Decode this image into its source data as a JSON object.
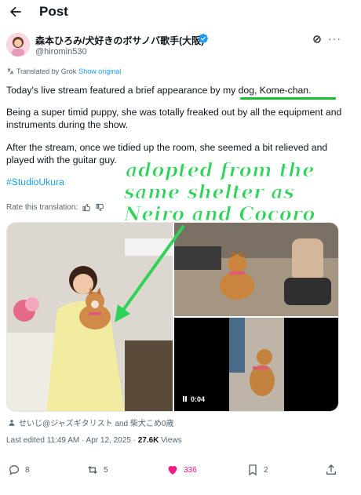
{
  "header": {
    "title": "Post"
  },
  "author": {
    "name": "森本ひろみ/犬好きのボサノバ歌手(大阪)",
    "handle": "@hiromin530"
  },
  "translation": {
    "label": "Translated by Grok",
    "show_original": "Show original"
  },
  "post": {
    "p1": "Today's live stream featured a brief appearance by my dog, Kome-chan.",
    "p2": "Being a super timid puppy, she was totally freaked out by all the equipment and instruments during the show.",
    "p3": "After the stream, once we tidied up the room, she seemed a bit relieved and played with the guitar guy.",
    "hashtag": "#StudioUkura"
  },
  "rate": {
    "label": "Rate this translation:"
  },
  "overlay": {
    "line1": "adopted from the",
    "line2": "same shelter as",
    "line3": "Neiro and Cocoro"
  },
  "media": {
    "video_time": "0:04"
  },
  "tagged": {
    "text": "せいじ@ジャズギタリスト and 柴犬こめ0歳"
  },
  "meta": {
    "edited": "Last edited 11:49 AM · Apr 12, 2025 ·",
    "views_count": "27.6K",
    "views_label": "Views"
  },
  "actions": {
    "replies": "8",
    "reposts": "5",
    "likes": "336",
    "bookmarks": "2"
  },
  "colors": {
    "accent": "#1d9bf0",
    "like": "#f91880",
    "overlay_green": "#2fd35a",
    "underline_green": "#16c12c"
  }
}
